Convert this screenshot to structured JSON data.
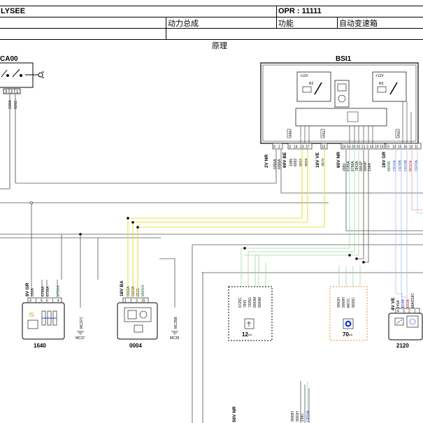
{
  "header": {
    "vehicle": "LYSEE",
    "opr": "OPR : 11111",
    "system": "动力总成",
    "function_label": "功能",
    "function_value": "自动变速箱",
    "principle": "原理"
  },
  "components": {
    "ca00": {
      "name": "CA00",
      "pins": [
        "3",
        "2",
        "1"
      ],
      "wires": [
        "100A",
        "8282"
      ]
    },
    "bsi1": {
      "name": "BSI1",
      "relay_supply_1": "+12V",
      "relay_supply_2": "+12V",
      "relay_1": "R2",
      "relay_2": "R3",
      "fuse_1": "F24",
      "fuse_2": "F21",
      "fuse_3": "F12",
      "connectors": [
        "2V NR",
        "60V BE",
        "16V VE",
        "60V NR",
        "16V GR"
      ],
      "pins_a": [
        "9",
        "2"
      ],
      "pins_b": [
        "3",
        "14",
        "23",
        "27"
      ],
      "pins_c": [
        "15"
      ],
      "pins_d": [
        "24",
        "53",
        "20",
        "31",
        "21",
        "3",
        "16",
        "19",
        "15"
      ],
      "pins_e": [
        "9",
        "14",
        "15",
        "16",
        "10",
        "11"
      ],
      "wires_a": [
        "6096A",
        "6096A"
      ],
      "wires_b": [
        "1095",
        "8282",
        "9032",
        "9034"
      ],
      "wires_c": [
        "2E21"
      ],
      "wires_d": [
        "2080",
        "6785A",
        "6798A",
        "7843A",
        "9001P",
        "9000P",
        "218A"
      ],
      "wires_e": [
        "MM5B",
        "CE01A",
        "CE33B",
        "CE01B",
        "BE02A",
        "CE01A"
      ]
    },
    "c1640": {
      "name": "1640",
      "connector": "6V GR",
      "pins": [
        "3",
        "2",
        "5",
        "6",
        "1",
        "4"
      ],
      "wires": [
        "200A",
        "6798A",
        "6738A",
        "M784A"
      ],
      "ground": "MC37",
      "ground_wire": "MC37C"
    },
    "c0004": {
      "name": "0004",
      "connector": "16V BA",
      "pins": [
        "1",
        "2",
        "3",
        "15"
      ],
      "wires": [
        "9032A",
        "9034A",
        "2E21",
        "MM504"
      ],
      "ground": "MC35",
      "ground_wire": "MC35B"
    },
    "c12": {
      "name": "12--",
      "wires": [
        "6725C",
        "7843",
        "7205G",
        "9001M",
        "9000M"
      ]
    },
    "c70": {
      "name": "70--",
      "wires": [
        "9001H",
        "9000H",
        "M07C",
        "9020C"
      ]
    },
    "c2120": {
      "name": "2120",
      "connector": "4V VE",
      "pins": [
        "4",
        "3",
        "2",
        "1"
      ],
      "wires": [
        "7245A",
        "CE01B",
        "BE02A",
        "218A/218C"
      ]
    },
    "bottom": {
      "connector": "56V NR",
      "wires": [
        "9000H",
        "9001H",
        "218C",
        "CE51A"
      ]
    }
  }
}
